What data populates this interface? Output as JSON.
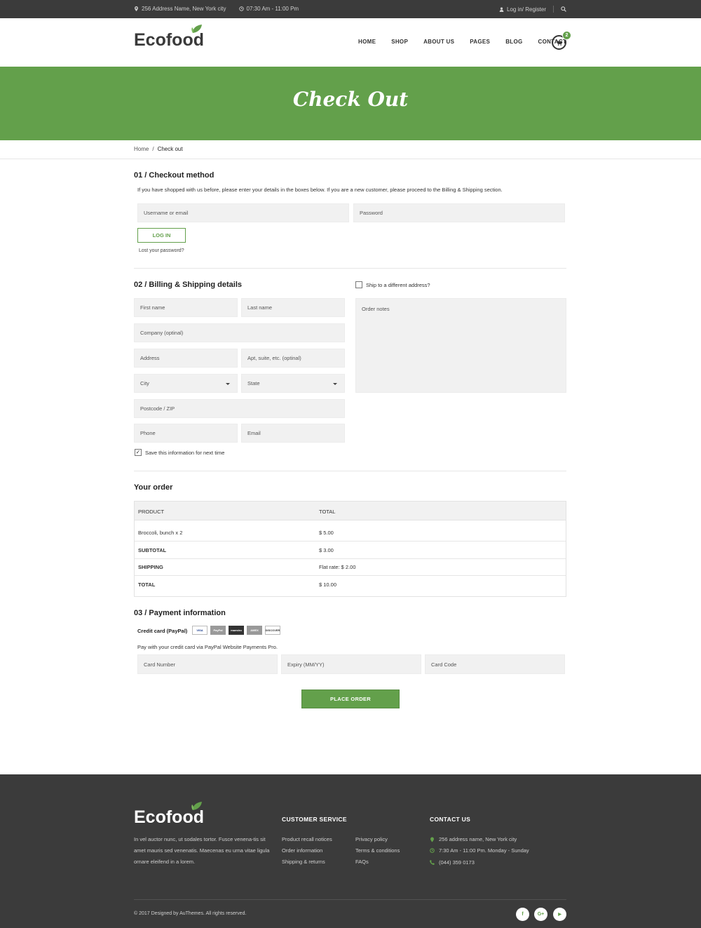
{
  "topbar": {
    "address": "256 Address Name, New York city",
    "hours": "07:30 Am - 11:00 Pm",
    "auth": "Log in/ Register"
  },
  "header": {
    "logo": "Ecofood",
    "nav": [
      "HOME",
      "SHOP",
      "ABOUT US",
      "PAGES",
      "BLOG",
      "CONTACT"
    ],
    "cart_count": "2"
  },
  "banner": {
    "title": "Check Out"
  },
  "breadcrumb": {
    "home": "Home",
    "sep": "/",
    "current": "Check out"
  },
  "checkout_method": {
    "title": "01 / Checkout method",
    "intro": "If you have shopped with us before, please enter your details in the boxes below. If you are a new customer, please proceed to the Billing & Shipping section.",
    "username_placeholder": "Username or email",
    "password_placeholder": "Password",
    "login_label": "LOG IN",
    "lost_password": "Lost your password?"
  },
  "billing": {
    "title": "02 / Billing & Shipping details",
    "ship_different": "Ship to a different address?",
    "first_name": "First name",
    "last_name": "Last name",
    "company": "Company (optinal)",
    "address": "Address",
    "apt": "Apt, suite, etc. (optinal)",
    "city": "City",
    "state": "State",
    "postcode": "Postcode / ZIP",
    "phone": "Phone",
    "email": "Email",
    "order_notes": "Order notes",
    "save_info": "Save this information for next time",
    "save_checked": "✓"
  },
  "order": {
    "title": "Your order",
    "col_product": "PRODUCT",
    "col_total": "TOTAL",
    "rows": [
      {
        "label": "Broccoli, bunch  x 2",
        "value": "$ 5.00"
      },
      {
        "label": "SUBTOTAL",
        "value": "$ 3.00"
      },
      {
        "label": "SHIPPING",
        "value": "Flat rate: $ 2.00"
      },
      {
        "label": "TOTAL",
        "value": "$ 10.00"
      }
    ]
  },
  "payment": {
    "title": "03 / Payment information",
    "method": "Credit card (PayPal)",
    "cards": [
      "VISA",
      "PayPal",
      "maestro",
      "AMEX",
      "DISCOVER"
    ],
    "desc": "Pay with your credit card via PayPal Website Payments Pro.",
    "card_number": "Card Number",
    "expiry": "Expiry (MM/YY)",
    "card_code": "Card Code",
    "place_order": "PLACE ORDER"
  },
  "footer": {
    "logo": "Ecofood",
    "about": "In vel auctor nunc, ut sodales tortor. Fusce venena-tis sit amet mauris sed venenatis. Maecenas eu urna vitae ligula ornare eleifend in a lorem.",
    "customer_service_title": "CUSTOMER SERVICE",
    "links_col1": [
      "Product recall notices",
      "Order information",
      "Shipping & returns"
    ],
    "links_col2": [
      "Privacy policy",
      "Terms & conditions",
      "FAQs"
    ],
    "contact_title": "CONTACT US",
    "contact_address": "256 address name, New York city",
    "contact_hours": "7:30 Am - 11:00 Pm. Monday - Sunday",
    "contact_phone": "(044) 359 0173",
    "copyright": "© 2017 Designed by AuThemes. All rights reserved.",
    "social": [
      "f",
      "G+",
      "▶"
    ]
  },
  "colors": {
    "brand_green": "#63a04b",
    "dark": "#3b3b3b",
    "field_bg": "#f1f1f1"
  }
}
